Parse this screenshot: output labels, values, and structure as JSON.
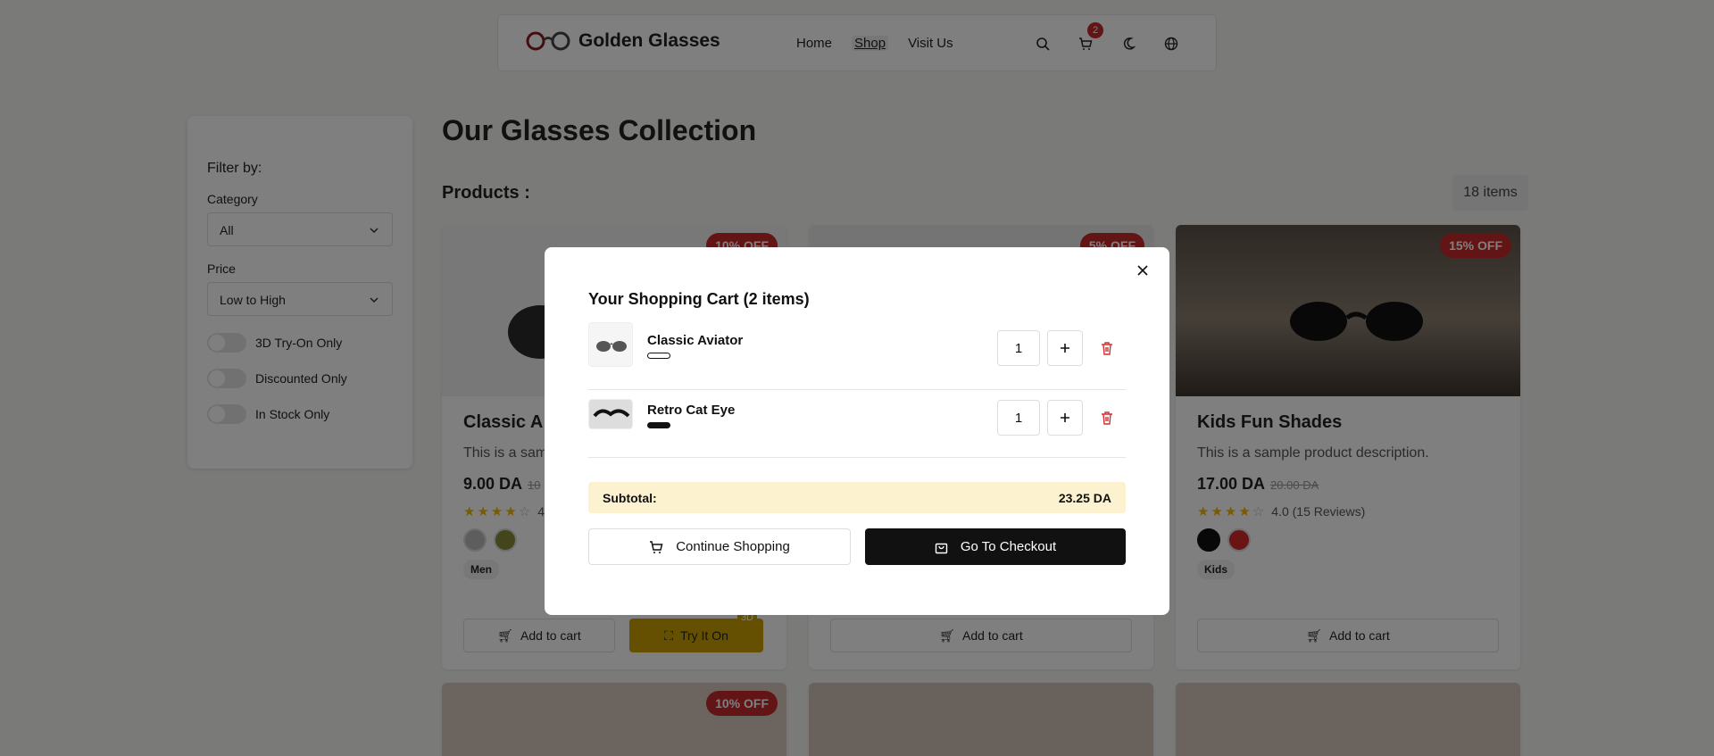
{
  "brand": {
    "name": "Golden Glasses"
  },
  "nav": {
    "links": [
      "Home",
      "Shop",
      "Visit Us"
    ],
    "active": "Shop",
    "cart_count": "2"
  },
  "sidebar": {
    "title": "Filter by:",
    "category_label": "Category",
    "category_value": "All",
    "price_label": "Price",
    "price_value": "Low to High",
    "toggles": [
      "3D Try-On Only",
      "Discounted Only",
      "In Stock Only"
    ]
  },
  "page": {
    "title": "Our Glasses Collection",
    "products_label": "Products :",
    "items_count": "18 items"
  },
  "products": [
    {
      "title": "Classic A",
      "desc": "This is a sam",
      "price": "9.00 DA",
      "old_price": "10",
      "rating_text": "4",
      "tag": "Men",
      "discount": "10% OFF",
      "add_label": "Add to cart",
      "try_label": "Try It On",
      "badge_3d": "3D"
    },
    {
      "discount": "5% OFF",
      "add_label": "Add to cart"
    },
    {
      "title": "Kids Fun Shades",
      "desc": "This is a sample product description.",
      "price": "17.00 DA",
      "old_price": "20.00 DA",
      "rating_text": "4.0 (15 Reviews)",
      "tag": "Kids",
      "discount": "15% OFF",
      "add_label": "Add to cart"
    },
    {
      "discount": "10% OFF"
    }
  ],
  "cart": {
    "title": "Your Shopping Cart (2 items)",
    "items": [
      {
        "name": "Classic Aviator",
        "qty": "1",
        "color": "#ffffff"
      },
      {
        "name": "Retro Cat Eye",
        "qty": "1",
        "color": "#111111"
      }
    ],
    "subtotal_label": "Subtotal:",
    "subtotal_value": "23.25 DA",
    "continue_label": "Continue Shopping",
    "checkout_label": "Go To Checkout"
  },
  "icons": [
    "glasses-logo-icon",
    "search-icon",
    "cart-icon",
    "moon-icon",
    "globe-icon",
    "close-icon",
    "plus-icon",
    "trash-icon",
    "shopping-bag-icon"
  ]
}
